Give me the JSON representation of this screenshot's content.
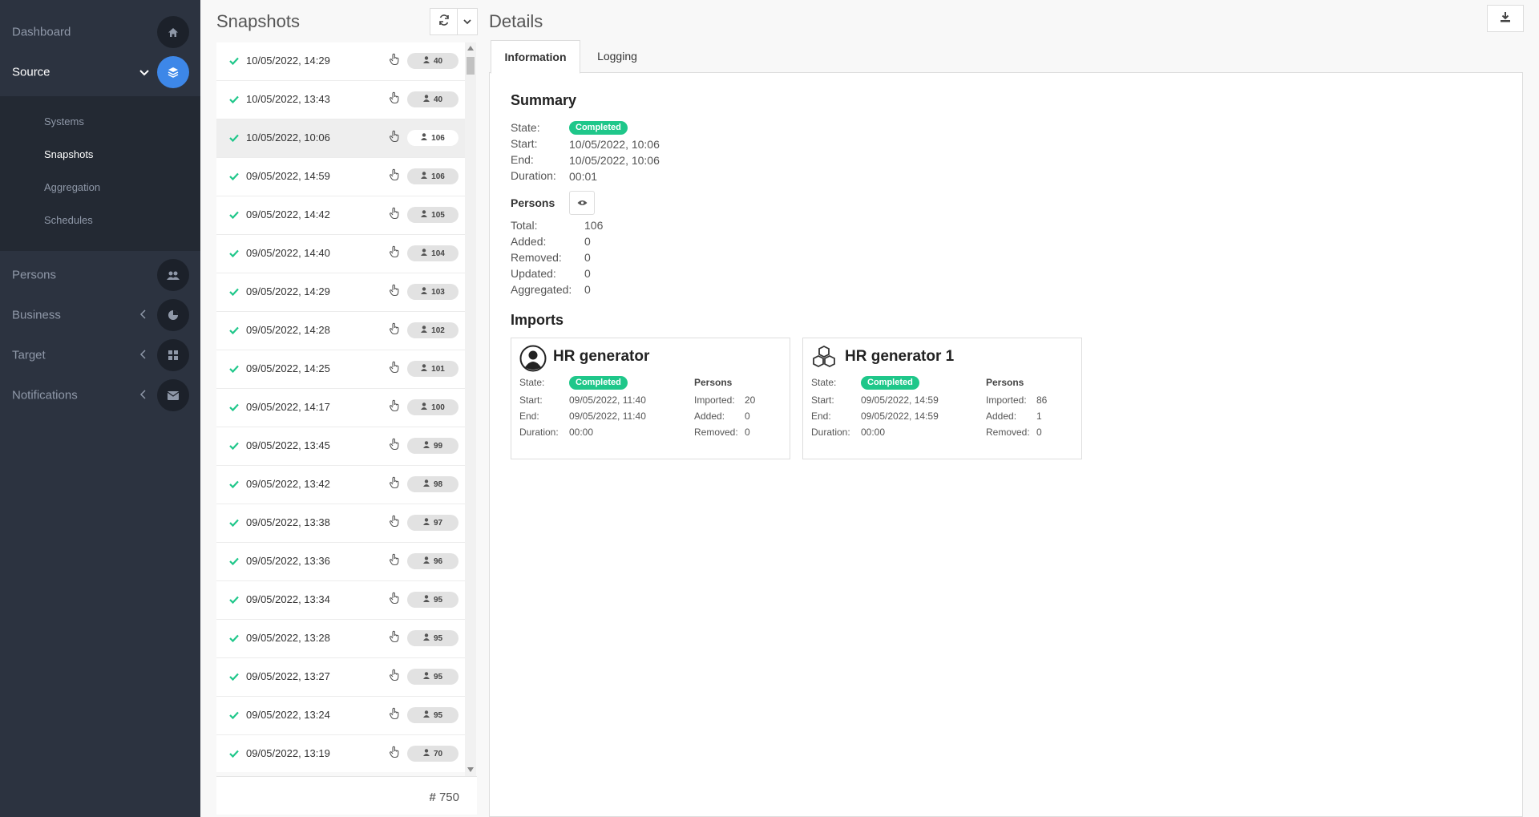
{
  "sidebar": {
    "dashboard": "Dashboard",
    "source": "Source",
    "source_sub": [
      "Systems",
      "Snapshots",
      "Aggregation",
      "Schedules"
    ],
    "persons": "Persons",
    "business": "Business",
    "target": "Target",
    "notifications": "Notifications"
  },
  "snapshots": {
    "title": "Snapshots",
    "rows": [
      {
        "date": "10/05/2022, 14:29",
        "count": "40"
      },
      {
        "date": "10/05/2022, 13:43",
        "count": "40"
      },
      {
        "date": "10/05/2022, 10:06",
        "count": "106"
      },
      {
        "date": "09/05/2022, 14:59",
        "count": "106"
      },
      {
        "date": "09/05/2022, 14:42",
        "count": "105"
      },
      {
        "date": "09/05/2022, 14:40",
        "count": "104"
      },
      {
        "date": "09/05/2022, 14:29",
        "count": "103"
      },
      {
        "date": "09/05/2022, 14:28",
        "count": "102"
      },
      {
        "date": "09/05/2022, 14:25",
        "count": "101"
      },
      {
        "date": "09/05/2022, 14:17",
        "count": "100"
      },
      {
        "date": "09/05/2022, 13:45",
        "count": "99"
      },
      {
        "date": "09/05/2022, 13:42",
        "count": "98"
      },
      {
        "date": "09/05/2022, 13:38",
        "count": "97"
      },
      {
        "date": "09/05/2022, 13:36",
        "count": "96"
      },
      {
        "date": "09/05/2022, 13:34",
        "count": "95"
      },
      {
        "date": "09/05/2022, 13:28",
        "count": "95"
      },
      {
        "date": "09/05/2022, 13:27",
        "count": "95"
      },
      {
        "date": "09/05/2022, 13:24",
        "count": "95"
      },
      {
        "date": "09/05/2022, 13:19",
        "count": "70"
      }
    ],
    "total": "750"
  },
  "details": {
    "title": "Details",
    "tabs": [
      "Information",
      "Logging"
    ],
    "summary": {
      "title": "Summary",
      "state_label": "State:",
      "state": "Completed",
      "start_label": "Start:",
      "start": "10/05/2022, 10:06",
      "end_label": "End:",
      "end": "10/05/2022, 10:06",
      "duration_label": "Duration:",
      "duration": "00:01"
    },
    "persons": {
      "title": "Persons",
      "total_label": "Total:",
      "total": "106",
      "added_label": "Added:",
      "added": "0",
      "removed_label": "Removed:",
      "removed": "0",
      "updated_label": "Updated:",
      "updated": "0",
      "aggregated_label": "Aggregated:",
      "aggregated": "0"
    },
    "imports_title": "Imports",
    "imports": [
      {
        "name": "HR generator",
        "state_label": "State:",
        "state": "Completed",
        "start_label": "Start:",
        "start": "09/05/2022, 11:40",
        "end_label": "End:",
        "end": "09/05/2022, 11:40",
        "duration_label": "Duration:",
        "duration": "00:00",
        "persons_title": "Persons",
        "imported_label": "Imported:",
        "imported": "20",
        "added_label": "Added:",
        "added": "0",
        "removed_label": "Removed:",
        "removed": "0"
      },
      {
        "name": "HR generator 1",
        "state_label": "State:",
        "state": "Completed",
        "start_label": "Start:",
        "start": "09/05/2022, 14:59",
        "end_label": "End:",
        "end": "09/05/2022, 14:59",
        "duration_label": "Duration:",
        "duration": "00:00",
        "persons_title": "Persons",
        "imported_label": "Imported:",
        "imported": "86",
        "added_label": "Added:",
        "added": "1",
        "removed_label": "Removed:",
        "removed": "0"
      }
    ]
  },
  "colors": {
    "accent": "#3d87e8",
    "success": "#1fc78a",
    "sidebar": "#2c3340"
  }
}
